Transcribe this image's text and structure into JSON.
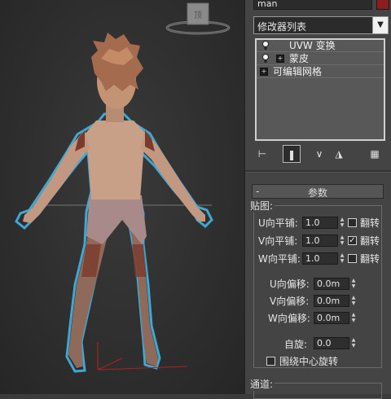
{
  "viewport": {
    "label": "viewport"
  },
  "panel": {
    "object_name": "man",
    "object_color": "#8b1d1d",
    "modifier_list_label": "修改器列表",
    "stack_items": [
      {
        "label": "UVW 变换"
      },
      {
        "label": "蒙皮"
      },
      {
        "label": "可编辑网格"
      }
    ],
    "toolbar_icons": [
      "pin-stack-icon",
      "show-end-result-icon",
      "make-unique-icon",
      "remove-modifier-icon",
      "configure-modifier-sets-icon"
    ],
    "rollout_title": "参数",
    "tile_group_title": "贴图:",
    "u_tile_label": "U向平铺:",
    "u_tile_value": "1.0",
    "u_flip_label": "翻转",
    "u_flip_checked": false,
    "v_tile_label": "V向平铺:",
    "v_tile_value": "1.0",
    "v_flip_label": "翻转",
    "v_flip_checked": true,
    "w_tile_label": "W向平铺:",
    "w_tile_value": "1.0",
    "w_flip_label": "翻转",
    "w_flip_checked": false,
    "u_offset_label": "U向偏移:",
    "u_offset_value": "0.0m",
    "v_offset_label": "V向偏移:",
    "v_offset_value": "0.0m",
    "w_offset_label": "W向偏移:",
    "w_offset_value": "0.0m",
    "rotation_label": "自旋:",
    "rotation_value": "0.0",
    "rotate_center_label": "围绕中心旋转",
    "rotate_center_checked": false,
    "channel_group_title": "通道:"
  },
  "colors": {
    "viewport_bg": "#2e2e2e",
    "panel_bg": "#444444",
    "selection_outline": "#3fb6e6"
  }
}
